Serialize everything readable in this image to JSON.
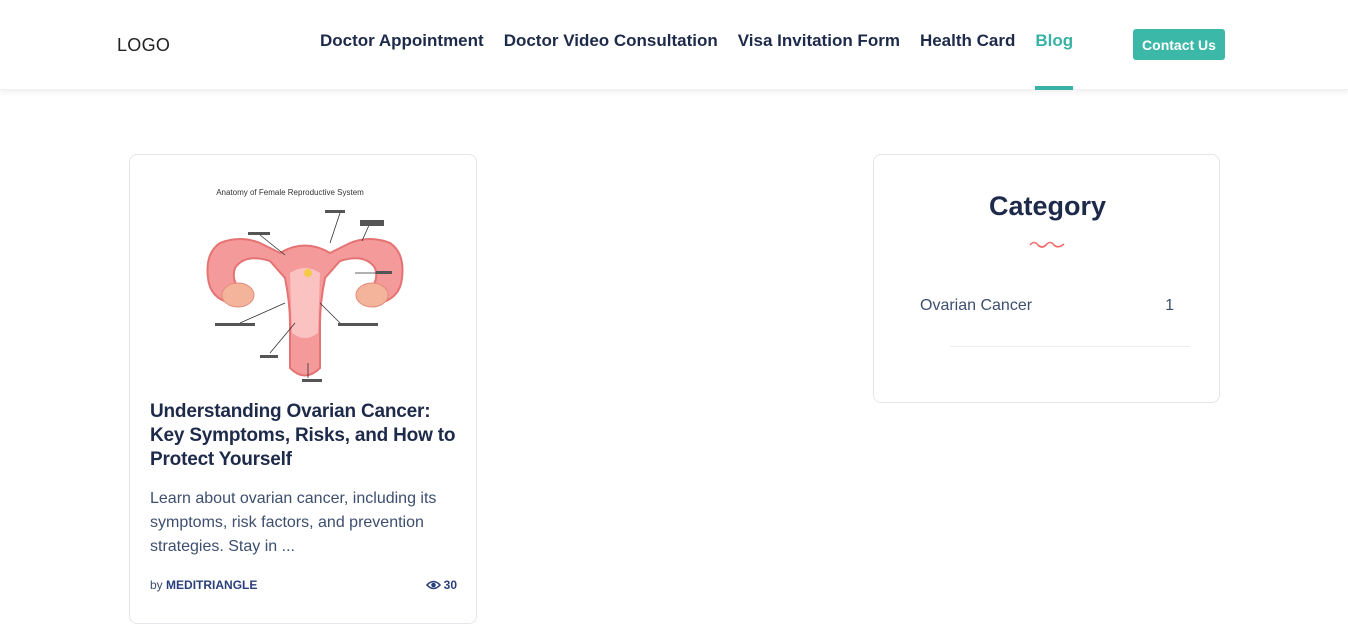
{
  "header": {
    "logo": "LOGO",
    "nav": [
      {
        "label": "Doctor Appointment"
      },
      {
        "label": "Doctor Video Consultation"
      },
      {
        "label": "Visa Invitation Form"
      },
      {
        "label": "Health Card"
      },
      {
        "label": "Blog",
        "active": true
      }
    ],
    "contact_label": "Contact Us"
  },
  "post": {
    "image_icon": "uterus-diagram-icon",
    "image_caption": "Anatomy of Female Reproductive System",
    "title": "Understanding Ovarian Cancer: Key Symptoms, Risks, and How to Protect Yourself",
    "excerpt": "Learn about ovarian cancer, including its symptoms, risk factors, and prevention strategies. Stay in ...",
    "by": "by",
    "author": "MEDITRIANGLE",
    "views": "30"
  },
  "sidebar": {
    "title": "Category",
    "categories": [
      {
        "name": "Ovarian Cancer",
        "count": "1"
      }
    ]
  },
  "colors": {
    "accent": "#38b2a4",
    "navy": "#1e2a4a",
    "squiggle": "#f26b6b"
  }
}
